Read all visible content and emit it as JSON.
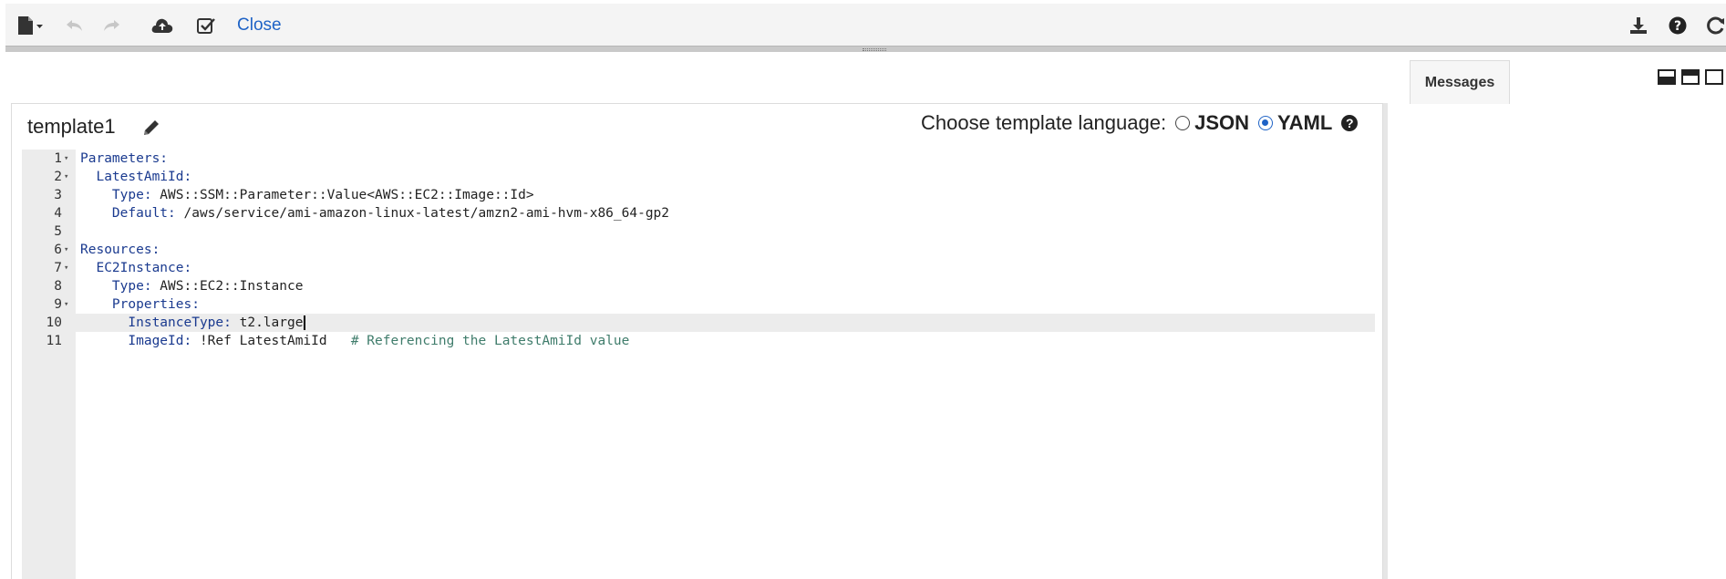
{
  "toolbar": {
    "close_label": "Close"
  },
  "messages": {
    "tab_label": "Messages"
  },
  "editor": {
    "title": "template1",
    "language_label": "Choose template language:",
    "languages": [
      "JSON",
      "YAML"
    ],
    "selected_language": "YAML",
    "lines": [
      {
        "n": "1",
        "fold": "▾",
        "key": "Parameters:",
        "val": "",
        "comment": ""
      },
      {
        "n": "2",
        "fold": "▾",
        "key": "  LatestAmiId:",
        "val": "",
        "comment": ""
      },
      {
        "n": "3",
        "fold": "",
        "key": "    Type:",
        "val": " AWS::SSM::Parameter::Value<AWS::EC2::Image::Id>",
        "comment": ""
      },
      {
        "n": "4",
        "fold": "",
        "key": "    Default:",
        "val": " /aws/service/ami-amazon-linux-latest/amzn2-ami-hvm-x86_64-gp2",
        "comment": ""
      },
      {
        "n": "5",
        "fold": "",
        "key": "",
        "val": "",
        "comment": ""
      },
      {
        "n": "6",
        "fold": "▾",
        "key": "Resources:",
        "val": "",
        "comment": ""
      },
      {
        "n": "7",
        "fold": "▾",
        "key": "  EC2Instance:",
        "val": "",
        "comment": ""
      },
      {
        "n": "8",
        "fold": "",
        "key": "    Type:",
        "val": " AWS::EC2::Instance",
        "comment": ""
      },
      {
        "n": "9",
        "fold": "▾",
        "key": "    Properties:",
        "val": "",
        "comment": ""
      },
      {
        "n": "10",
        "fold": "",
        "key": "      InstanceType:",
        "val": " t2.large",
        "comment": ""
      },
      {
        "n": "11",
        "fold": "",
        "key": "      ImageId:",
        "val": " !Ref LatestAmiId   ",
        "comment": "# Referencing the LatestAmiId value"
      }
    ]
  },
  "icons": {
    "new": "file-icon",
    "undo": "undo-icon",
    "redo": "redo-icon",
    "upload": "cloud-upload-icon",
    "validate": "check-square-icon",
    "download": "download-icon",
    "help": "question-circle-icon",
    "refresh": "refresh-icon"
  },
  "colors": {
    "link": "#1f63c6",
    "keyword": "#1a3a8f",
    "comment": "#3f7c6b"
  }
}
